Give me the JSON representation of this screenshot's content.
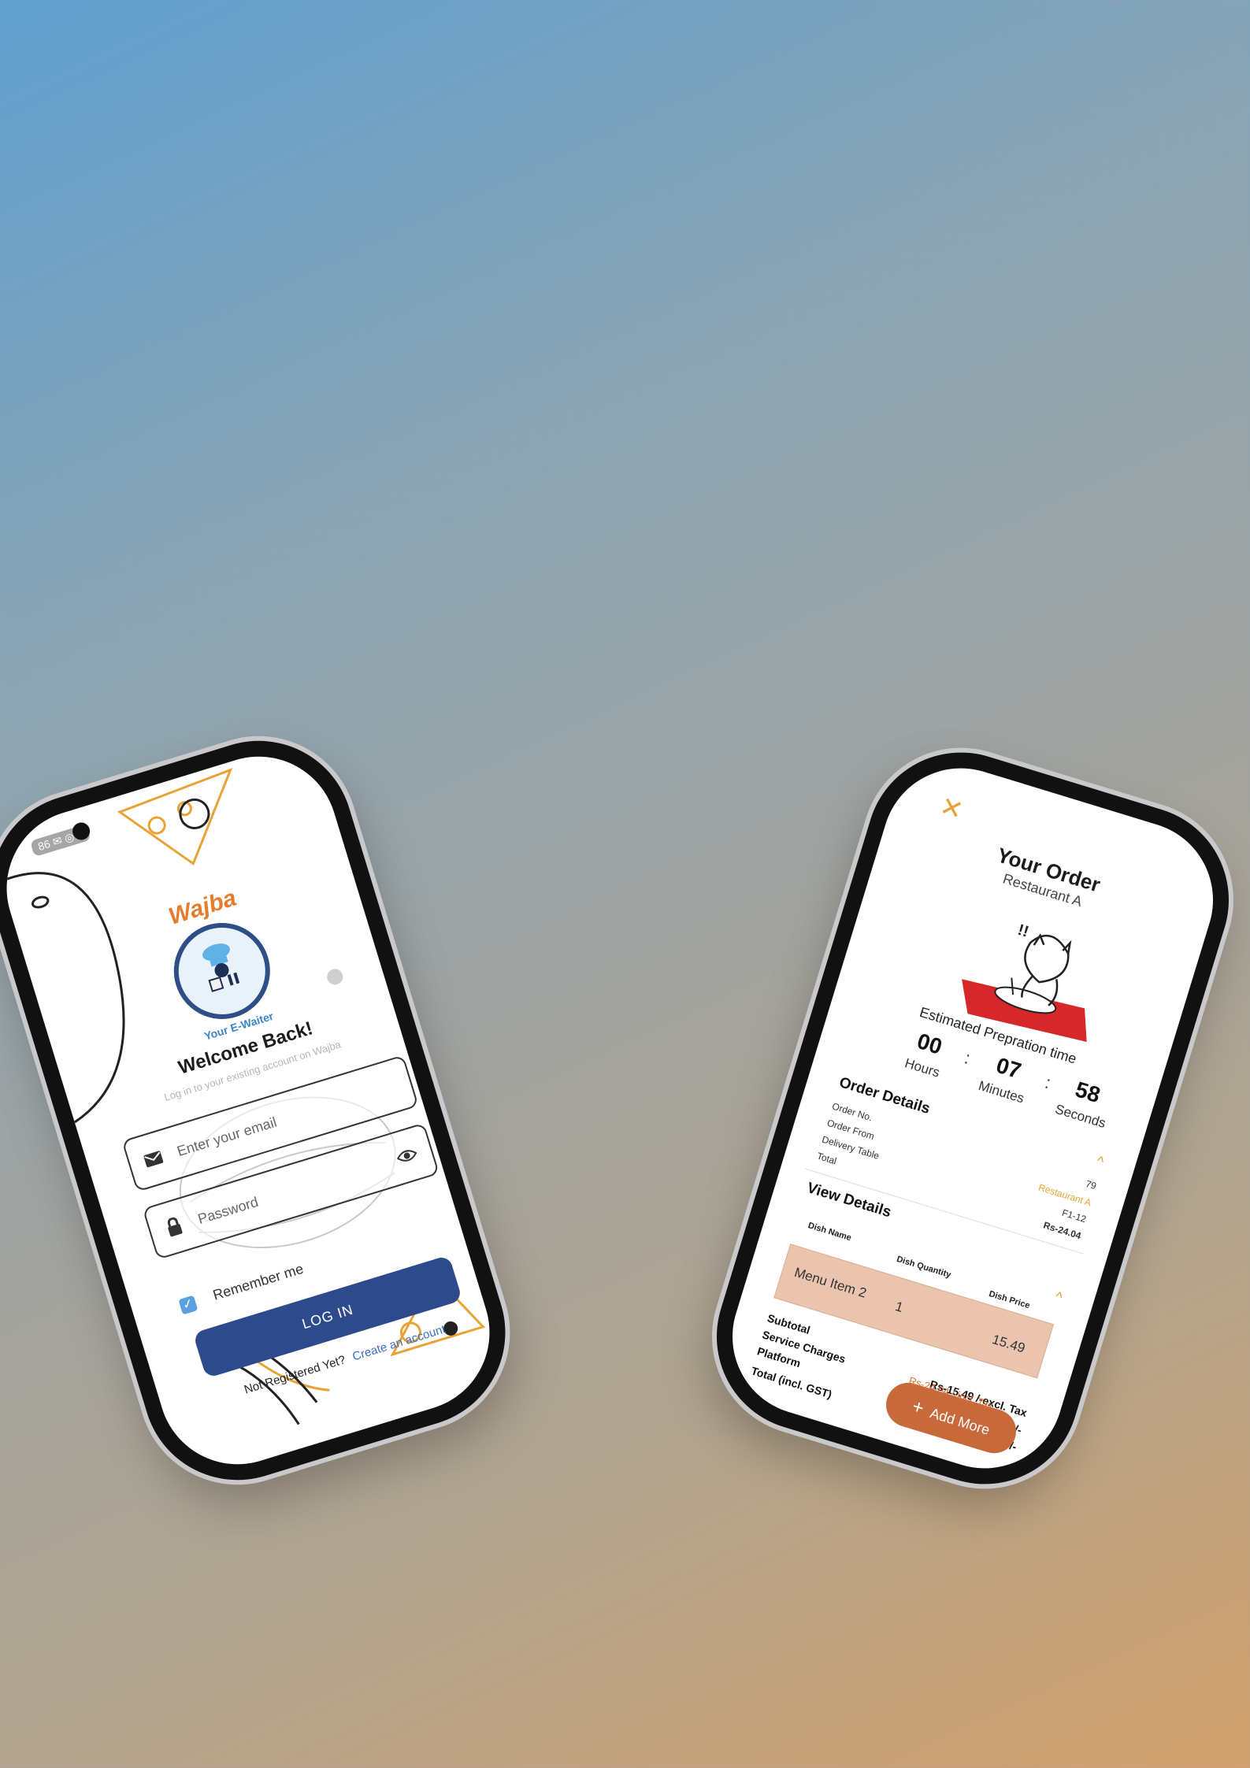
{
  "login": {
    "status_left": "86 ✉ ◎ ▮",
    "logo": {
      "title": "Wajba",
      "subtitle": "Your E-Waiter"
    },
    "welcome_title": "Welcome Back!",
    "welcome_sub": "Log in to your existing account on Wajba",
    "email_placeholder": "Enter your email",
    "password_placeholder": "Password",
    "remember_label": "Remember me",
    "remember_checked": true,
    "login_button": "LOG IN",
    "not_registered": "Not Registered Yet?",
    "create_account": "Create an account",
    "icons": [
      "mail-icon",
      "lock-icon",
      "eye-icon",
      "check-icon"
    ],
    "accent_color": "#2c4a8c",
    "doodle_color": "#e7a336"
  },
  "order": {
    "close_icon": "✕",
    "title": "Your Order",
    "restaurant": "Restaurant A",
    "estimated_label": "Estimated Prepration time",
    "timer": {
      "hours": "00",
      "hours_label": "Hours",
      "minutes": "07",
      "minutes_label": "Minutes",
      "seconds": "58",
      "seconds_label": "Seconds",
      "sep": ":"
    },
    "order_details": {
      "title": "Order Details",
      "rows": [
        {
          "label": "Order No.",
          "value": "79"
        },
        {
          "label": "Order From",
          "value": "Restaurant A"
        },
        {
          "label": "Delivery Table",
          "value": "F1-12"
        },
        {
          "label": "Total",
          "value": "Rs-24.04"
        }
      ],
      "chevron": "^"
    },
    "view_details": {
      "title": "View Details",
      "headers": [
        "Dish Name",
        "Dish Quantity",
        "Dish Price"
      ],
      "items": [
        {
          "name": "Menu Item 2",
          "qty": "1",
          "price": "15.49"
        }
      ],
      "chevron": "^"
    },
    "summary": {
      "subtotal_label": "Subtotal",
      "service_label": "Service Charges",
      "platform_label": "Platform",
      "total_label": "Total (incl. GST)",
      "subtotal_value": "Rs-15.49 /-excl. Tax",
      "service_value": "Rs-1.55 /-",
      "platform_value": "Rs-4.99 /-",
      "total_value": "Rs-24.04 /-incl. Tax"
    },
    "add_more": "Add More",
    "accent_color": "#c8693c",
    "highlight_color": "#eac4ae"
  }
}
